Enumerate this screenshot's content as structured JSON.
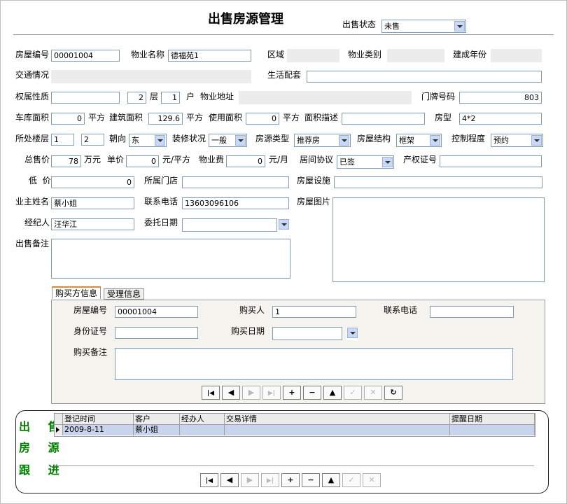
{
  "header": {
    "title": "出售房源管理",
    "status_label": "出售状态",
    "status_value": "未售"
  },
  "row1": {
    "house_no_label": "房屋编号",
    "house_no": "00001004",
    "property_name_label": "物业名称",
    "property_name": "德福苑1",
    "area_label": "区域",
    "property_type_label": "物业类别",
    "build_year_label": "建成年份"
  },
  "row2": {
    "traffic_label": "交通情况",
    "facilities_label": "生活配套"
  },
  "row3": {
    "ownership_label": "权属性质",
    "floor_value": "2",
    "floor_label": "层",
    "unit_value": "1",
    "unit_label": "户",
    "address_label": "物业地址",
    "door_no_label": "门牌号码",
    "door_no": "803"
  },
  "row4": {
    "garage_label": "车库面积",
    "garage_value": "0",
    "sqm1": "平方",
    "build_area_label": "建筑面积",
    "build_area": "129.6",
    "sqm2": "平方",
    "use_area_label": "使用面积",
    "use_area": "0",
    "sqm3": "平方",
    "area_desc_label": "面积描述",
    "layout_label": "房型",
    "layout": "4*2"
  },
  "row5": {
    "floor_pos_label": "所处楼层",
    "floor_a": "1",
    "floor_b": "2",
    "orientation_label": "朝向",
    "orientation": "东",
    "decoration_label": "装修状况",
    "decoration": "一般",
    "source_type_label": "房源类型",
    "source_type": "推荐房",
    "structure_label": "房屋结构",
    "structure": "框架",
    "control_label": "控制程度",
    "control": "预约"
  },
  "row6": {
    "total_price_label": "总售价",
    "total_price": "78",
    "wan_yuan": "万元",
    "unit_price_label": "单价",
    "unit_price": "0",
    "yuan_sqm": "元/平方",
    "fee_label": "物业费",
    "fee": "0",
    "yuan_month": "元/月",
    "agreement_label": "居间协议",
    "agreement": "已签",
    "cert_label": "产权证号"
  },
  "row7": {
    "low_price_label": "低  价",
    "low_price": "0",
    "store_label": "所属门店",
    "equip_label": "房屋设施"
  },
  "row8": {
    "owner_label": "业主姓名",
    "owner": "蔡小姐",
    "phone_label": "联系电话",
    "phone": "13603096106",
    "photo_label": "房屋图片"
  },
  "row9": {
    "agent_label": "经纪人",
    "agent": "汪华江",
    "commission_date_label": "委托日期"
  },
  "row10": {
    "remark_label": "出售备注"
  },
  "tabs": [
    {
      "label": "购买方信息"
    },
    {
      "label": "受理信息"
    }
  ],
  "buyer": {
    "house_no_label": "房屋编号",
    "house_no": "00001004",
    "buyer_label": "购买人",
    "buyer": "1",
    "phone_label": "联系电话",
    "id_label": "身份证号",
    "date_label": "购买日期",
    "remark_label": "购买备注"
  },
  "nav_buttons": [
    {
      "icon": "first-icon",
      "glyph": "|◀",
      "enabled": true
    },
    {
      "icon": "prev-icon",
      "glyph": "◀",
      "enabled": true
    },
    {
      "icon": "next-icon",
      "glyph": "▶",
      "enabled": false
    },
    {
      "icon": "last-icon",
      "glyph": "▶|",
      "enabled": false
    },
    {
      "icon": "add-icon",
      "glyph": "+",
      "enabled": true
    },
    {
      "icon": "delete-icon",
      "glyph": "−",
      "enabled": true
    },
    {
      "icon": "edit-icon",
      "glyph": "▲",
      "enabled": true
    },
    {
      "icon": "post-icon",
      "glyph": "✓",
      "enabled": false
    },
    {
      "icon": "cancel-icon",
      "glyph": "✕",
      "enabled": false
    },
    {
      "icon": "refresh-icon",
      "glyph": "↻",
      "enabled": true
    }
  ],
  "followup": {
    "side_title_1": "出 售",
    "side_title_2": "房 源",
    "side_title_3": "跟 进",
    "columns": [
      "登记时间",
      "客户",
      "经办人",
      "交易详情",
      "提醒日期"
    ],
    "rows": [
      [
        "2009-8-11",
        "蔡小姐",
        "",
        "",
        ""
      ]
    ]
  }
}
